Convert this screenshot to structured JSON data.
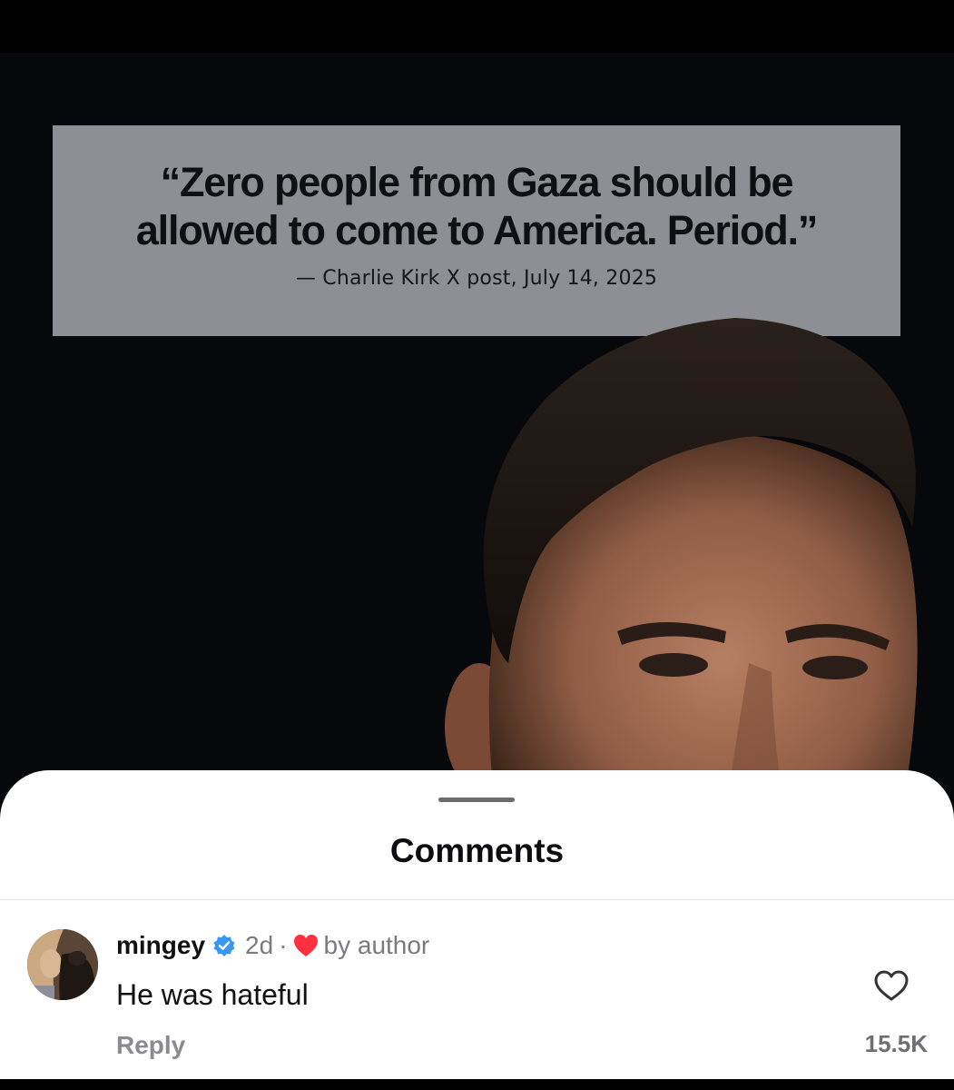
{
  "media": {
    "quote": "“Zero people from Gaza should be allowed to come to America. Period.”",
    "attribution": "— Charlie Kirk X post, July 14, 2025",
    "card_color": "#8d8f94",
    "portrait_alt": "photo-of-man"
  },
  "sheet": {
    "title": "Comments"
  },
  "comment": {
    "username": "mingey",
    "verified_icon": "verified-badge-icon",
    "age": "2d",
    "separator": "·",
    "author_like_label": "by author",
    "text": "He was hateful",
    "reply_label": "Reply",
    "like_count": "15.5K",
    "like_icon": "heart-outline-icon"
  },
  "colors": {
    "verified_blue": "#3897f0",
    "heart_red": "#ff3040"
  }
}
